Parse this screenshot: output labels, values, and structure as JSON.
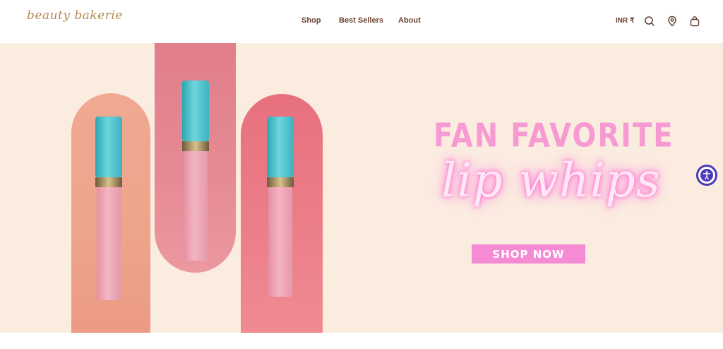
{
  "brand": {
    "logo_text": "beauty bakerie"
  },
  "nav": {
    "items": [
      {
        "label": "Shop"
      },
      {
        "label": "Best Sellers"
      },
      {
        "label": "About"
      }
    ]
  },
  "header": {
    "currency": "INR ₹",
    "icons": [
      "search-icon",
      "location-pin-icon",
      "shopping-bag-icon"
    ]
  },
  "hero": {
    "headline": "FAN FAVORITE",
    "script_text": "lip whips",
    "button_label": "SHOP NOW",
    "colors": {
      "background": "#fbece0",
      "accent": "#f58bd4",
      "headline": "#f79ad3"
    }
  },
  "accessibility": {
    "icon": "accessibility-icon"
  }
}
